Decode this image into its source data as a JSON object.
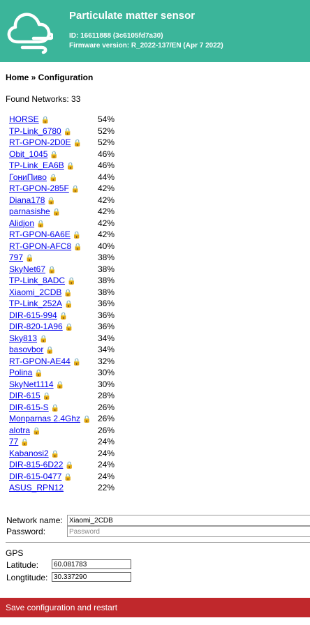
{
  "header": {
    "title": "Particulate matter sensor",
    "id_line": "ID: 16611888 (3c6105fd7a30)",
    "firmware_line": "Firmware version: R_2022-137/EN (Apr 7 2022)",
    "logo_icon": "cloud-wind-icon",
    "bg_color": "#3bb59a"
  },
  "breadcrumb": "Home » Configuration",
  "found_networks": "Found Networks: 33",
  "networks": [
    {
      "ssid": "HORSE",
      "signal": "54%",
      "locked": true
    },
    {
      "ssid": "TP-Link_6780",
      "signal": "52%",
      "locked": true
    },
    {
      "ssid": "RT-GPON-2D0E",
      "signal": "52%",
      "locked": true
    },
    {
      "ssid": "Obit_1045",
      "signal": "46%",
      "locked": true
    },
    {
      "ssid": "TP-Link_EA6B",
      "signal": "46%",
      "locked": true
    },
    {
      "ssid": "ГониПиво",
      "signal": "44%",
      "locked": true
    },
    {
      "ssid": "RT-GPON-285F",
      "signal": "42%",
      "locked": true
    },
    {
      "ssid": "Diana178",
      "signal": "42%",
      "locked": true
    },
    {
      "ssid": "parnasishe",
      "signal": "42%",
      "locked": true
    },
    {
      "ssid": "Alidjon",
      "signal": "42%",
      "locked": true
    },
    {
      "ssid": "RT-GPON-6A6E",
      "signal": "42%",
      "locked": true
    },
    {
      "ssid": "RT-GPON-AFC8",
      "signal": "40%",
      "locked": true
    },
    {
      "ssid": "797",
      "signal": "38%",
      "locked": true
    },
    {
      "ssid": "SkyNet67",
      "signal": "38%",
      "locked": true
    },
    {
      "ssid": "TP-Link_8ADC",
      "signal": "38%",
      "locked": true
    },
    {
      "ssid": "Xiaomi_2CDB",
      "signal": "38%",
      "locked": true
    },
    {
      "ssid": "TP-Link_252A",
      "signal": "36%",
      "locked": true
    },
    {
      "ssid": "DIR-615-994",
      "signal": "36%",
      "locked": true
    },
    {
      "ssid": "DIR-820-1A96",
      "signal": "36%",
      "locked": true
    },
    {
      "ssid": "Sky813",
      "signal": "34%",
      "locked": true
    },
    {
      "ssid": "basovbor",
      "signal": "34%",
      "locked": true
    },
    {
      "ssid": "RT-GPON-AE44",
      "signal": "32%",
      "locked": true
    },
    {
      "ssid": "Polina",
      "signal": "30%",
      "locked": true
    },
    {
      "ssid": "SkyNet1114",
      "signal": "30%",
      "locked": true
    },
    {
      "ssid": "DIR-615",
      "signal": "28%",
      "locked": true
    },
    {
      "ssid": "DIR-615-S",
      "signal": "26%",
      "locked": true
    },
    {
      "ssid": "Monparnas 2.4Ghz",
      "signal": "26%",
      "locked": true
    },
    {
      "ssid": "alotra",
      "signal": "26%",
      "locked": true
    },
    {
      "ssid": "77",
      "signal": "24%",
      "locked": true
    },
    {
      "ssid": "Kabanosi2",
      "signal": "24%",
      "locked": true
    },
    {
      "ssid": "DIR-815-6D22",
      "signal": "24%",
      "locked": true
    },
    {
      "ssid": "DIR-615-0477",
      "signal": "24%",
      "locked": true
    },
    {
      "ssid": "ASUS_RPN12",
      "signal": "22%",
      "locked": false
    }
  ],
  "form": {
    "network_name_label": "Network name:",
    "network_name_value": "Xiaomi_2CDB",
    "password_label": "Password:",
    "password_placeholder": "Password"
  },
  "gps": {
    "label": "GPS",
    "latitude_label": "Latitude:",
    "latitude_value": "60.081783",
    "longitude_label": "Longtitude:",
    "longitude_value": "30.337290"
  },
  "save_button": {
    "label": "Save configuration and restart",
    "color": "#c0282c"
  }
}
